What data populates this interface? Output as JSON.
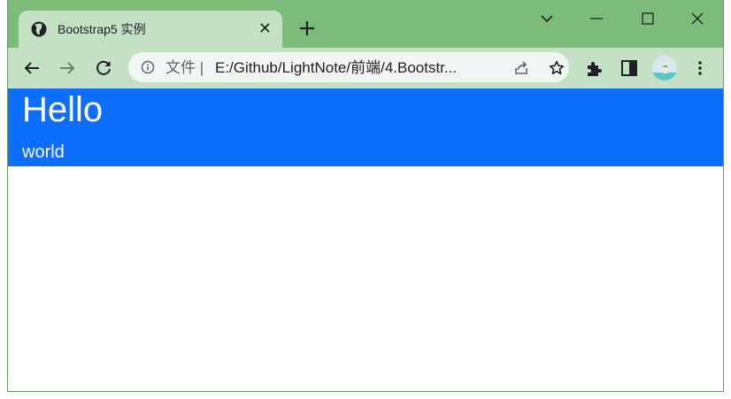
{
  "browser": {
    "tab": {
      "title": "Bootstrap5 实例",
      "favicon": "globe-icon",
      "close_glyph": "✕"
    },
    "address_bar": {
      "label": "文件",
      "separator": "|",
      "url": "E:/Github/LightNote/前端/4.Bootstr..."
    },
    "colors": {
      "frame": "#7dbb7a",
      "toolbar": "#c4e1c6",
      "omnibox": "#f2f6f2"
    },
    "icons": [
      "back-icon",
      "forward-icon",
      "reload-icon",
      "info-icon",
      "share-icon",
      "star-icon",
      "extensions-icon",
      "side-panel-icon",
      "profile-avatar",
      "menu-icon",
      "tab-search-icon",
      "minimize-icon",
      "maximize-icon",
      "close-icon"
    ]
  },
  "page": {
    "heading": "Hello",
    "subheading": "world",
    "banner_color": "#0d6efd"
  }
}
